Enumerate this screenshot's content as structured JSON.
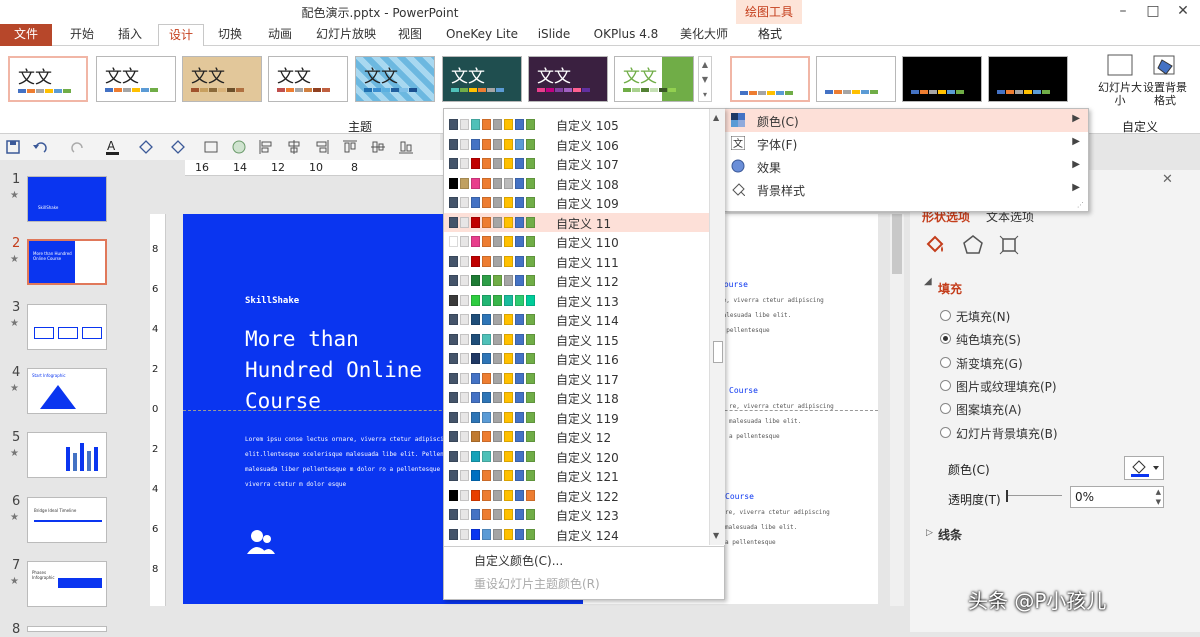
{
  "app": {
    "title": "配色演示.pptx - PowerPoint",
    "context_group": "绘图工具"
  },
  "window": {
    "minimize": "–",
    "restore": "□",
    "close": "✕"
  },
  "tabs": [
    "文件",
    "开始",
    "插入",
    "设计",
    "切换",
    "动画",
    "幻灯片放映",
    "视图",
    "OneKey Lite",
    "iSlide",
    "OKPlus 4.8",
    "美化大师",
    "格式"
  ],
  "ribbon": {
    "theme_group": "主题",
    "custom_group": "自定义",
    "slide_size": "幻灯片大小",
    "format_bg": "设置背景格式",
    "theme_text": "文文",
    "theme_glyph": "文",
    "scroll_up": "▲",
    "scroll_down": "▼",
    "more": "▾"
  },
  "ruler": {
    "marks": [
      "16",
      "14",
      "12",
      "10",
      "8"
    ],
    "vmarks": [
      "8",
      "6",
      "4",
      "2",
      "0",
      "2",
      "4",
      "6",
      "8"
    ]
  },
  "qat": {
    "icons": [
      "save-icon",
      "undo-icon",
      "redo-icon",
      "font-color-icon",
      "shape-fill-icon",
      "shape-outline-icon"
    ]
  },
  "thumbnails": [
    {
      "num": "1",
      "star": "★",
      "label": "SkillShake"
    },
    {
      "num": "2",
      "star": "★",
      "label": "More than Hundred Online Course"
    },
    {
      "num": "3",
      "star": "★"
    },
    {
      "num": "4",
      "star": "★",
      "label": "Start Infographic"
    },
    {
      "num": "5",
      "star": "★"
    },
    {
      "num": "6",
      "star": "★",
      "label": "Bridge Ideal Timeline"
    },
    {
      "num": "7",
      "star": "★",
      "label": "Phases Infographic"
    },
    {
      "num": "8"
    }
  ],
  "slide": {
    "brand": "SkillShake",
    "headline": [
      "More than",
      "Hundred Online",
      "Course"
    ],
    "body": [
      "Lorem ipsu conse lectus ornare, viverra ctetur adipiscing",
      "elit.llentesque scelerisque malesuada libe elit. Pellentes",
      "malesuada liber pellentesque m dolor ro a pellentesque ornar",
      "viverra ctetur m dolor esque"
    ],
    "right_blocks": [
      {
        "title": "Course",
        "lines": [
          "re, viverra ctetur adipiscing",
          "malesuada libe elit.",
          "a pellentesque"
        ]
      },
      {
        "title": "Course",
        "lines": [
          "re, viverra ctetur adipiscing",
          "malesuada libe elit.",
          "a pellentesque"
        ]
      },
      {
        "title": "Course",
        "lines": [
          "re, viverra ctetur adipiscing",
          "malesuada libe elit.",
          "a pellentesque"
        ]
      }
    ]
  },
  "dropdown": {
    "items": [
      {
        "label": "自定义 105",
        "colors": [
          "#44546a",
          "#e7e6e6",
          "#4fc0b8",
          "#ed7d31",
          "#a5a5a5",
          "#ffc000",
          "#4472c4",
          "#70ad47"
        ]
      },
      {
        "label": "自定义 106",
        "colors": [
          "#44546a",
          "#e7e6e6",
          "#4472c4",
          "#ed7d31",
          "#a5a5a5",
          "#ffc000",
          "#5b9bd5",
          "#70ad47"
        ]
      },
      {
        "label": "自定义 107",
        "colors": [
          "#44546a",
          "#e7e6e6",
          "#c00000",
          "#ed7d31",
          "#a5a5a5",
          "#ffc000",
          "#4472c4",
          "#70ad47"
        ]
      },
      {
        "label": "自定义 108",
        "colors": [
          "#000000",
          "#c0a060",
          "#e83e8c",
          "#ed7d31",
          "#a5a5a5",
          "#bbbbbb",
          "#4472c4",
          "#70ad47"
        ]
      },
      {
        "label": "自定义 109",
        "colors": [
          "#44546a",
          "#e7e6e6",
          "#4472c4",
          "#ed7d31",
          "#a5a5a5",
          "#ffc000",
          "#4472c4",
          "#70ad47"
        ]
      },
      {
        "label": "自定义 11",
        "colors": [
          "#44546a",
          "#e7e6e6",
          "#c00000",
          "#ed7d31",
          "#a5a5a5",
          "#ffc000",
          "#4472c4",
          "#70ad47"
        ]
      },
      {
        "label": "自定义 110",
        "colors": [
          "#ffffff",
          "#e7e6e6",
          "#e83e8c",
          "#ed7d31",
          "#a5a5a5",
          "#ffc000",
          "#4472c4",
          "#70ad47"
        ]
      },
      {
        "label": "自定义 111",
        "colors": [
          "#44546a",
          "#e7e6e6",
          "#c00000",
          "#ed7d31",
          "#a5a5a5",
          "#ffc000",
          "#4472c4",
          "#70ad47"
        ]
      },
      {
        "label": "自定义 112",
        "colors": [
          "#44546a",
          "#e7e6e6",
          "#1e7b34",
          "#2e9e48",
          "#70ad47",
          "#a5a5a5",
          "#4472c4",
          "#70ad47"
        ]
      },
      {
        "label": "自定义 113",
        "colors": [
          "#3a3a3a",
          "#e7e6e6",
          "#2ecc40",
          "#22b573",
          "#39b54a",
          "#1abc9c",
          "#2ecc71",
          "#00cc99"
        ]
      },
      {
        "label": "自定义 114",
        "colors": [
          "#44546a",
          "#e7e6e6",
          "#1f4e79",
          "#2e75b6",
          "#a5a5a5",
          "#ffc000",
          "#4472c4",
          "#70ad47"
        ]
      },
      {
        "label": "自定义 115",
        "colors": [
          "#44546a",
          "#e7e6e6",
          "#1f4e79",
          "#4fc0b8",
          "#a5a5a5",
          "#ffc000",
          "#4472c4",
          "#70ad47"
        ]
      },
      {
        "label": "自定义 116",
        "colors": [
          "#44546a",
          "#e7e6e6",
          "#1f3864",
          "#2e75b6",
          "#a5a5a5",
          "#ffc000",
          "#4472c4",
          "#70ad47"
        ]
      },
      {
        "label": "自定义 117",
        "colors": [
          "#44546a",
          "#e7e6e6",
          "#4472c4",
          "#ed7d31",
          "#a5a5a5",
          "#ffc000",
          "#4472c4",
          "#70ad47"
        ]
      },
      {
        "label": "自定义 118",
        "colors": [
          "#44546a",
          "#e7e6e6",
          "#4472c4",
          "#2e75b6",
          "#a5a5a5",
          "#ffc000",
          "#4472c4",
          "#70ad47"
        ]
      },
      {
        "label": "自定义 119",
        "colors": [
          "#44546a",
          "#e7e6e6",
          "#2e75b6",
          "#5b9bd5",
          "#a5a5a5",
          "#ffc000",
          "#4472c4",
          "#70ad47"
        ]
      },
      {
        "label": "自定义 12",
        "colors": [
          "#44546a",
          "#e7e6e6",
          "#c07a30",
          "#ed7d31",
          "#a5a5a5",
          "#ffc000",
          "#4472c4",
          "#70ad47"
        ]
      },
      {
        "label": "自定义 120",
        "colors": [
          "#44546a",
          "#e7e6e6",
          "#17a2b8",
          "#4fc0b8",
          "#a5a5a5",
          "#ffc000",
          "#4472c4",
          "#70ad47"
        ]
      },
      {
        "label": "自定义 121",
        "colors": [
          "#44546a",
          "#e7e6e6",
          "#0070c0",
          "#ed7d31",
          "#a5a5a5",
          "#ffc000",
          "#4472c4",
          "#70ad47"
        ]
      },
      {
        "label": "自定义 122",
        "colors": [
          "#000000",
          "#e7e6e6",
          "#e83e00",
          "#ed7d31",
          "#a5a5a5",
          "#ffc000",
          "#4472c4",
          "#ed7d31"
        ]
      },
      {
        "label": "自定义 123",
        "colors": [
          "#44546a",
          "#e7e6e6",
          "#4472c4",
          "#ed7d31",
          "#a5a5a5",
          "#ffc000",
          "#4472c4",
          "#70ad47"
        ]
      },
      {
        "label": "自定义 124",
        "colors": [
          "#44546a",
          "#e7e6e6",
          "#0a35f0",
          "#5b9bd5",
          "#a5a5a5",
          "#ffc000",
          "#4472c4",
          "#70ad47"
        ]
      }
    ],
    "selected_index": 5,
    "custom_colors": "自定义颜色(C)...",
    "reset_colors": "重设幻灯片主题颜色(R)"
  },
  "menu": {
    "items": [
      {
        "label": "颜色(C)",
        "icon": "color-palette-icon"
      },
      {
        "label": "字体(F)",
        "icon": "font-icon"
      },
      {
        "label": "效果",
        "icon": "effects-icon"
      },
      {
        "label": "背景样式",
        "icon": "background-style-icon"
      }
    ],
    "arrow": "▶"
  },
  "panel": {
    "close": "✕",
    "tab_shape": "形状选项",
    "tab_text": "文本选项",
    "section": "填充",
    "section_line": "线条",
    "options": [
      "无填充(N)",
      "纯色填充(S)",
      "渐变填充(G)",
      "图片或纹理填充(P)",
      "图案填充(A)",
      "幻灯片背景填充(B)"
    ],
    "selected_option": 1,
    "color_label": "颜色(C)",
    "transparency_label": "透明度(T)",
    "transparency_value": "0%"
  },
  "watermark": "头条 @P小孩儿",
  "colors": {
    "accent": "#c43e1c",
    "slide_blue": "#0a35f0",
    "file_tab": "#b7472a"
  }
}
